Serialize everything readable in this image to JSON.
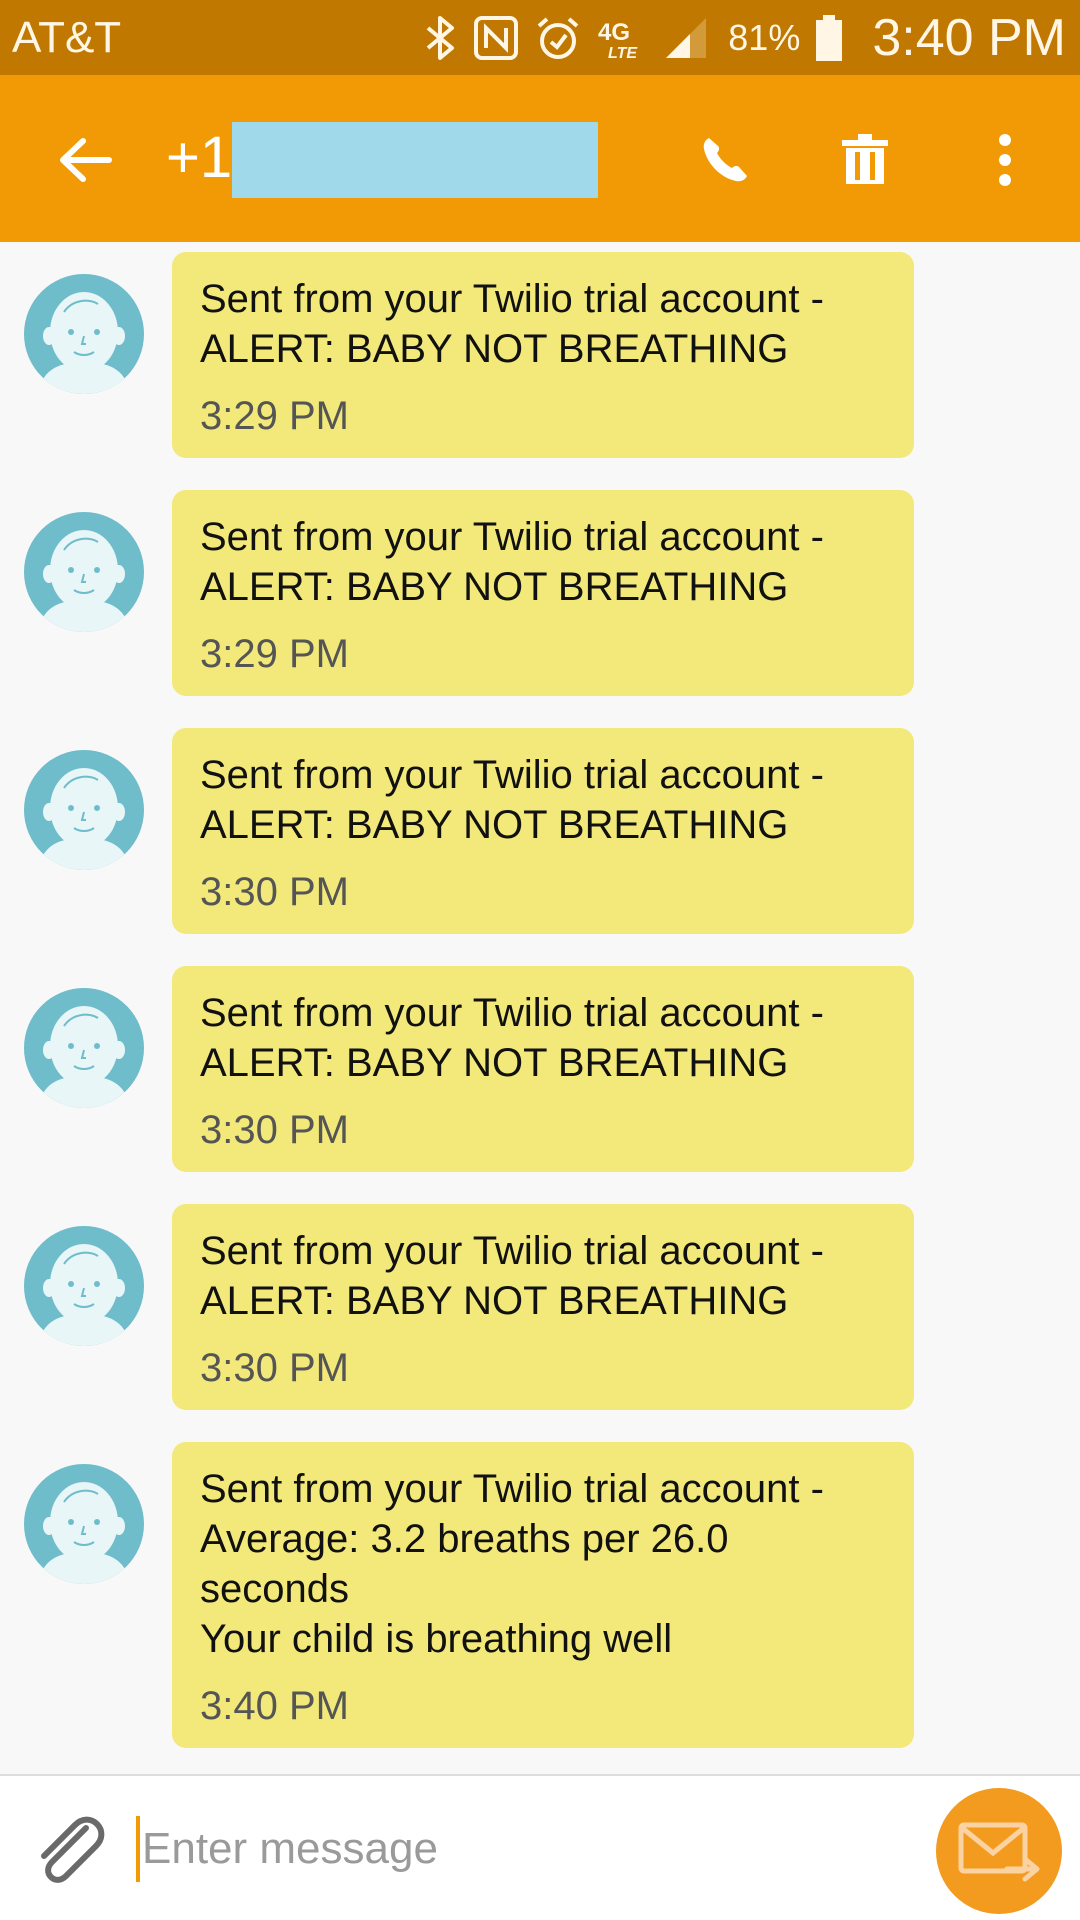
{
  "status_bar": {
    "carrier": "AT&T",
    "network": "4G LTE",
    "battery": "81%",
    "time": "3:40 PM",
    "icons": [
      "bluetooth-icon",
      "nfc-icon",
      "alarm-icon",
      "4g-lte-icon",
      "signal-icon",
      "battery-icon"
    ]
  },
  "app_bar": {
    "contact_prefix": "+1",
    "actions": [
      "back",
      "call",
      "delete",
      "more"
    ]
  },
  "messages": [
    {
      "text": "Sent from your Twilio trial account - ALERT: BABY NOT BREATHING",
      "time": "3:29 PM"
    },
    {
      "text": "Sent from your Twilio trial account - ALERT: BABY NOT BREATHING",
      "time": "3:29 PM"
    },
    {
      "text": "Sent from your Twilio trial account - ALERT: BABY NOT BREATHING",
      "time": "3:30 PM"
    },
    {
      "text": "Sent from your Twilio trial account - ALERT: BABY NOT BREATHING",
      "time": "3:30 PM"
    },
    {
      "text": "Sent from your Twilio trial account - ALERT: BABY NOT BREATHING",
      "time": "3:30 PM"
    },
    {
      "text": "Sent from your Twilio trial account - Average: 3.2 breaths per 26.0 seconds\nYour child is breathing well",
      "time": "3:40 PM"
    }
  ],
  "composer": {
    "placeholder": "Enter message",
    "value": ""
  },
  "colors": {
    "status_bar": "#c07800",
    "app_bar": "#f19a06",
    "bubble": "#f2e97a",
    "avatar": "#6fbccb",
    "send_button": "#f39b1f"
  }
}
